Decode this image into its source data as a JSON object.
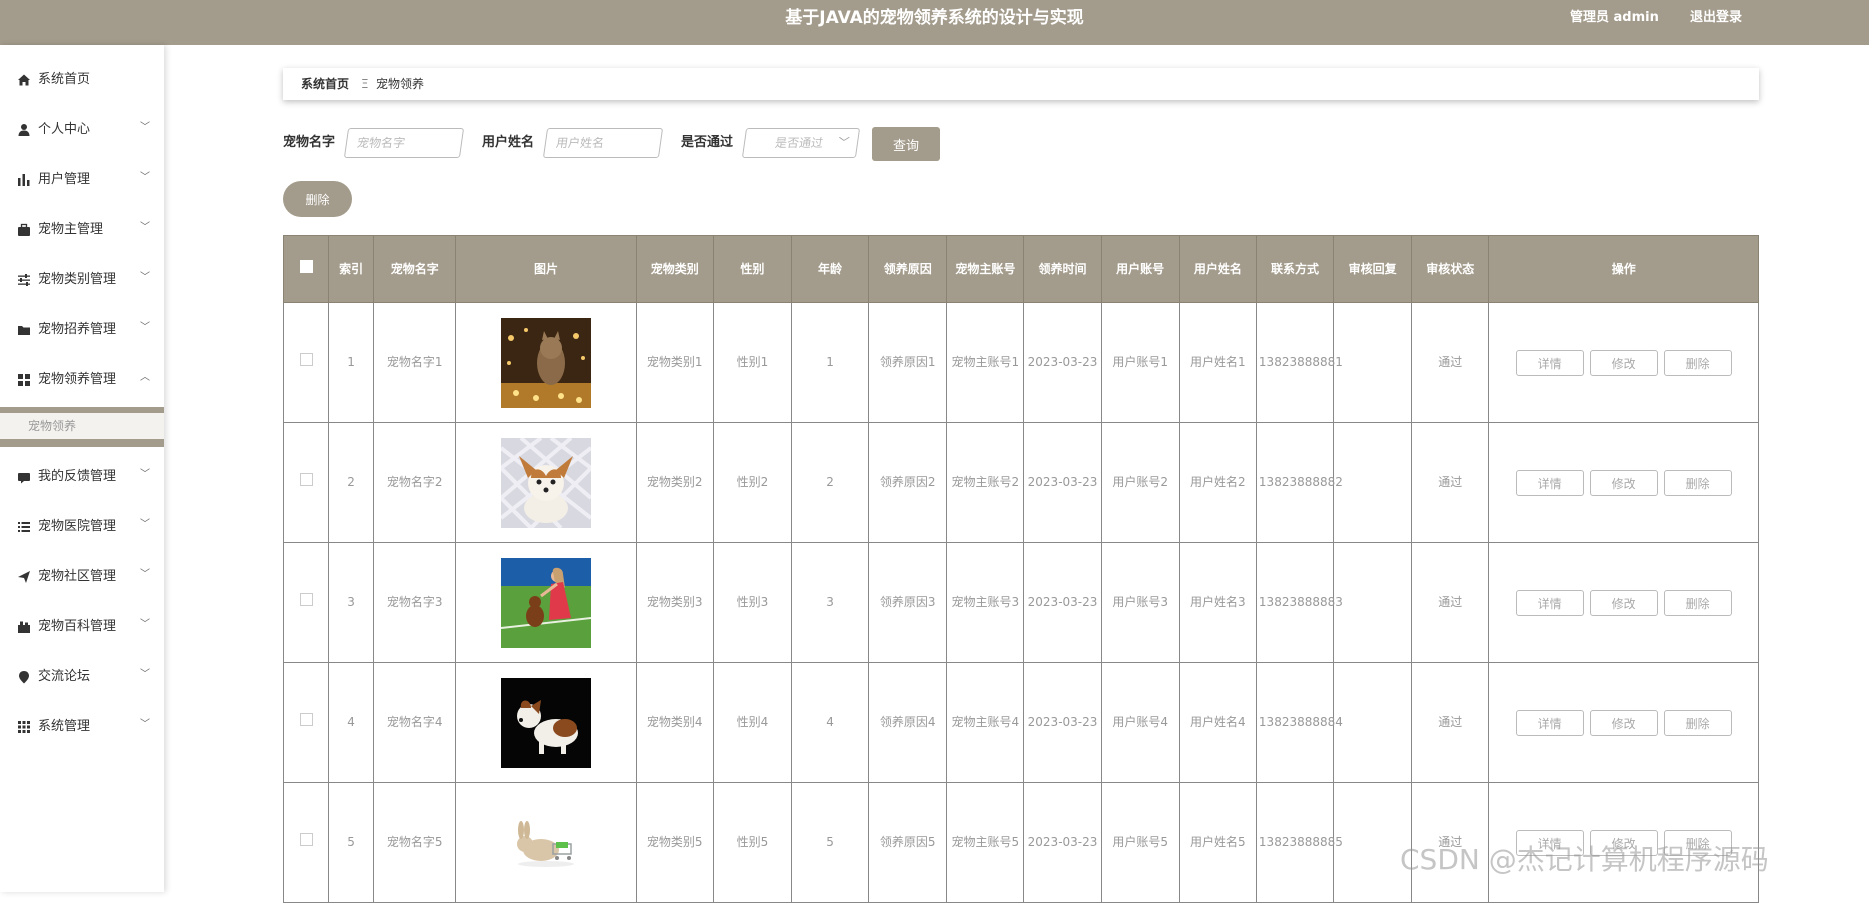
{
  "header": {
    "title": "基于JAVA的宠物领养系统的设计与实现",
    "user": "管理员 admin",
    "logout": "退出登录",
    "bg_color": "#a39b8b"
  },
  "sidebar": {
    "items": [
      {
        "label": "系统首页",
        "icon": "home-icon",
        "has_arrow": false
      },
      {
        "label": "个人中心",
        "icon": "user-icon",
        "has_arrow": true
      },
      {
        "label": "用户管理",
        "icon": "bar-chart-icon",
        "has_arrow": true
      },
      {
        "label": "宠物主管理",
        "icon": "briefcase-icon",
        "has_arrow": true
      },
      {
        "label": "宠物类别管理",
        "icon": "sliders-icon",
        "has_arrow": true
      },
      {
        "label": "宠物招养管理",
        "icon": "folder-icon",
        "has_arrow": true
      },
      {
        "label": "宠物领养管理",
        "icon": "grid-icon",
        "has_arrow": true,
        "expanded": true
      },
      {
        "label": "我的反馈管理",
        "icon": "reply-icon",
        "has_arrow": true
      },
      {
        "label": "宠物医院管理",
        "icon": "list-icon",
        "has_arrow": true
      },
      {
        "label": "宠物社区管理",
        "icon": "send-icon",
        "has_arrow": true
      },
      {
        "label": "宠物百科管理",
        "icon": "book-icon",
        "has_arrow": true
      },
      {
        "label": "交流论坛",
        "icon": "pin-icon",
        "has_arrow": true
      },
      {
        "label": "系统管理",
        "icon": "apps-icon",
        "has_arrow": true
      }
    ],
    "submenu_active": "宠物领养"
  },
  "breadcrumb": {
    "home": "系统首页",
    "separator": "Ξ",
    "current": "宠物领养"
  },
  "filters": {
    "pet_name_label": "宠物名字",
    "pet_name_placeholder": "宠物名字",
    "user_name_label": "用户姓名",
    "user_name_placeholder": "用户姓名",
    "approved_label": "是否通过",
    "approved_placeholder": "是否通过",
    "query_button": "查询",
    "delete_button": "删除"
  },
  "table": {
    "columns": [
      "索引",
      "宠物名字",
      "图片",
      "宠物类别",
      "性别",
      "年龄",
      "领养原因",
      "宠物主账号",
      "领养时间",
      "用户账号",
      "用户姓名",
      "联系方式",
      "审核回复",
      "审核状态",
      "操作"
    ],
    "rows": [
      {
        "index": "1",
        "pet_name": "宠物名字1",
        "image": "cat-photo",
        "category": "宠物类别1",
        "gender": "性别1",
        "age": "1",
        "reason": "领养原因1",
        "owner_account": "宠物主账号1",
        "adopt_time": "2023-03-23",
        "user_account": "用户账号1",
        "user_name": "用户姓名1",
        "phone": "13823888881",
        "reply": "",
        "status": "通过"
      },
      {
        "index": "2",
        "pet_name": "宠物名字2",
        "image": "chihuahua-photo",
        "category": "宠物类别2",
        "gender": "性别2",
        "age": "2",
        "reason": "领养原因2",
        "owner_account": "宠物主账号2",
        "adopt_time": "2023-03-23",
        "user_account": "用户账号2",
        "user_name": "用户姓名2",
        "phone": "13823888882",
        "reply": "",
        "status": "通过"
      },
      {
        "index": "3",
        "pet_name": "宠物名字3",
        "image": "girl-with-dog-photo",
        "category": "宠物类别3",
        "gender": "性别3",
        "age": "3",
        "reason": "领养原因3",
        "owner_account": "宠物主账号3",
        "adopt_time": "2023-03-23",
        "user_account": "用户账号3",
        "user_name": "用户姓名3",
        "phone": "13823888883",
        "reply": "",
        "status": "通过"
      },
      {
        "index": "4",
        "pet_name": "宠物名字4",
        "image": "puppy-photo",
        "category": "宠物类别4",
        "gender": "性别4",
        "age": "4",
        "reason": "领养原因4",
        "owner_account": "宠物主账号4",
        "adopt_time": "2023-03-23",
        "user_account": "用户账号4",
        "user_name": "用户姓名4",
        "phone": "13823888884",
        "reply": "",
        "status": "通过"
      },
      {
        "index": "5",
        "pet_name": "宠物名字5",
        "image": "rabbit-photo",
        "category": "宠物类别5",
        "gender": "性别5",
        "age": "5",
        "reason": "领养原因5",
        "owner_account": "宠物主账号5",
        "adopt_time": "2023-03-23",
        "user_account": "用户账号5",
        "user_name": "用户姓名5",
        "phone": "13823888885",
        "reply": "",
        "status": "通过"
      }
    ],
    "actions": [
      "详情",
      "修改",
      "删除"
    ]
  },
  "watermark": "CSDN @杰记计算机程序源码"
}
